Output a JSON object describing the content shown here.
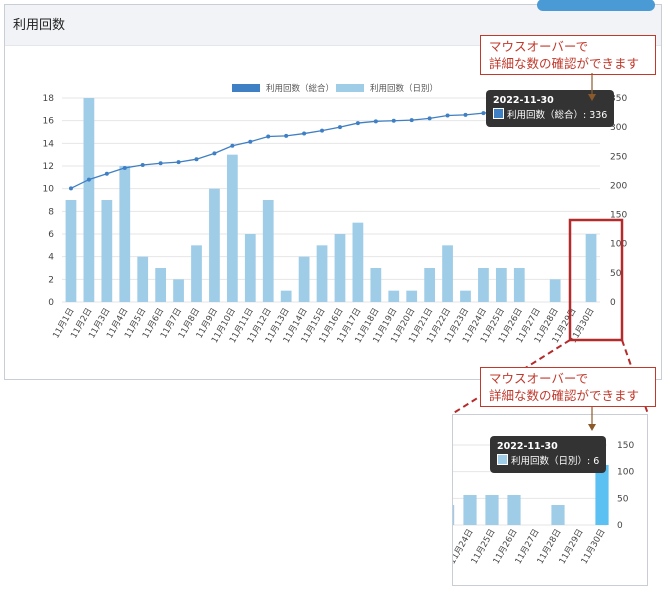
{
  "title": "利用回数",
  "callout_text": "マウスオーバーで\n詳細な数の確認ができます",
  "chart_data": {
    "type": "bar+line",
    "categories": [
      "11月1日",
      "11月2日",
      "11月3日",
      "11月4日",
      "11月5日",
      "11月6日",
      "11月7日",
      "11月8日",
      "11月9日",
      "11月10日",
      "11月11日",
      "11月12日",
      "11月13日",
      "11月14日",
      "11月15日",
      "11月16日",
      "11月17日",
      "11月18日",
      "11月19日",
      "11月20日",
      "11月21日",
      "11月22日",
      "11月23日",
      "11月24日",
      "11月25日",
      "11月26日",
      "11月27日",
      "11月28日",
      "11月29日",
      "11月30日"
    ],
    "series": [
      {
        "name": "利用回数（日別）",
        "type": "bar",
        "axis": "left",
        "color": "#9fcde8",
        "values": [
          9,
          18,
          9,
          12,
          4,
          3,
          2,
          5,
          10,
          13,
          6,
          9,
          1,
          4,
          5,
          6,
          7,
          3,
          1,
          1,
          3,
          5,
          1,
          3,
          3,
          3,
          0,
          2,
          0,
          6
        ]
      },
      {
        "name": "利用回数（総合）",
        "type": "line",
        "axis": "right",
        "color": "#3f7fc4",
        "values": [
          195,
          210,
          220,
          230,
          235,
          238,
          240,
          245,
          255,
          268,
          275,
          284,
          285,
          289,
          294,
          300,
          307,
          310,
          311,
          312,
          315,
          320,
          321,
          324,
          327,
          330,
          330,
          332,
          332,
          338
        ]
      }
    ],
    "y_left": {
      "min": 0,
      "max": 18,
      "ticks": [
        0,
        2,
        4,
        6,
        8,
        10,
        12,
        14,
        16,
        18
      ]
    },
    "y_right": {
      "min": 0,
      "max": 350,
      "ticks": [
        0,
        50,
        100,
        150,
        200,
        250,
        300,
        350
      ]
    },
    "legend": {
      "position": "top"
    }
  },
  "tooltip_total": {
    "date": "2022-11-30",
    "label": "利用回数（総合）: 336"
  },
  "tooltip_daily": {
    "date": "2022-11-30",
    "label": "利用回数（日別）: 6"
  },
  "zoom": {
    "categories": [
      "11月24日",
      "11月25日",
      "11月26日",
      "11月27日",
      "11月28日",
      "11月29日",
      "11月30日"
    ],
    "ticks": [
      0,
      50,
      100,
      150
    ]
  }
}
